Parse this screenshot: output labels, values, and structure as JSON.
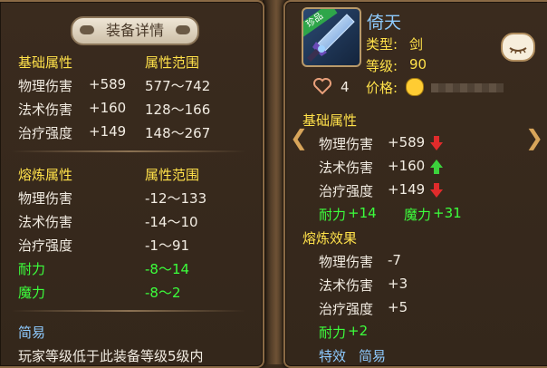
{
  "left": {
    "title": "装备详情",
    "basic": {
      "header": "基础属性",
      "range_header": "属性范围",
      "rows": [
        {
          "name": "物理伤害",
          "value": "+589",
          "range": "577～742"
        },
        {
          "name": "法术伤害",
          "value": "+160",
          "range": "128～166"
        },
        {
          "name": "治疗强度",
          "value": "+149",
          "range": "148～267"
        }
      ]
    },
    "refine": {
      "header": "熔炼属性",
      "range_header": "属性范围",
      "rows": [
        {
          "name": "物理伤害",
          "range": "-12～133"
        },
        {
          "name": "法术伤害",
          "range": "-14～10"
        },
        {
          "name": "治疗强度",
          "range": "-1～91"
        },
        {
          "name": "耐力",
          "range": "-8～14"
        },
        {
          "name": "魔力",
          "range": "-8～2"
        }
      ]
    },
    "simple": {
      "header": "简易",
      "text": "玩家等级低于此装备等级5级内"
    }
  },
  "right": {
    "item_name": "倚天",
    "badge": "珍品",
    "type_label": "类型:",
    "type_value": "剑",
    "level_label": "等级:",
    "level_value": "90",
    "likes": "4",
    "price_label": "价格:",
    "basic": {
      "header": "基础属性",
      "rows": [
        {
          "name": "物理伤害",
          "value": "+589",
          "trend": "down"
        },
        {
          "name": "法术伤害",
          "value": "+160",
          "trend": "up"
        },
        {
          "name": "治疗强度",
          "value": "+149",
          "trend": "down"
        }
      ],
      "extra": [
        {
          "name": "耐力",
          "value": "+14"
        },
        {
          "name": "魔力",
          "value": "+31"
        }
      ]
    },
    "refine": {
      "header": "熔炼效果",
      "rows": [
        {
          "name": "物理伤害",
          "value": "-7"
        },
        {
          "name": "法术伤害",
          "value": "+3"
        },
        {
          "name": "治疗强度",
          "value": "+5"
        }
      ],
      "extra": {
        "name": "耐力",
        "value": "+2"
      }
    },
    "footer": {
      "effect": "特效",
      "simple": "简易"
    }
  },
  "colors": {
    "heading": "#ffe14a",
    "positive": "#3cff3c",
    "link": "#8ecbff",
    "text": "#f2ece2"
  }
}
